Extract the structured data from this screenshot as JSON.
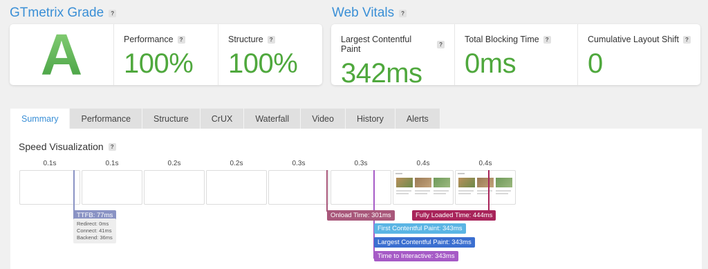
{
  "grade_section": {
    "title": "GTmetrix Grade",
    "help": "?",
    "grade": "A"
  },
  "grade_metrics": [
    {
      "label": "Performance",
      "help": "?",
      "value": "100%"
    },
    {
      "label": "Structure",
      "help": "?",
      "value": "100%"
    }
  ],
  "vitals_section": {
    "title": "Web Vitals",
    "help": "?"
  },
  "vitals": [
    {
      "label": "Largest Contentful Paint",
      "help": "?",
      "value": "342ms"
    },
    {
      "label": "Total Blocking Time",
      "help": "?",
      "value": "0ms"
    },
    {
      "label": "Cumulative Layout Shift",
      "help": "?",
      "value": "0"
    }
  ],
  "tabs": [
    "Summary",
    "Performance",
    "Structure",
    "CrUX",
    "Waterfall",
    "Video",
    "History",
    "Alerts"
  ],
  "active_tab": "Summary",
  "speed": {
    "title": "Speed Visualization",
    "help": "?",
    "frame_labels": [
      "0.1s",
      "0.1s",
      "0.2s",
      "0.2s",
      "0.3s",
      "0.3s",
      "0.4s",
      "0.4s"
    ],
    "markers": {
      "ttfb": "TTFB: 77ms",
      "onload": "Onload Time: 301ms",
      "fully_loaded": "Fully Loaded Time: 444ms",
      "fcp": "First Contentful Paint: 343ms",
      "lcp": "Largest Contentful Paint: 343ms",
      "tti": "Time to Interactive: 343ms"
    },
    "ttfb_details": [
      "Redirect: 0ms",
      "Connect: 41ms",
      "Backend: 36ms"
    ]
  },
  "colors": {
    "accent": "#3a8fd6",
    "grade_green": "#4fa83d",
    "ttfb": "#8a93c4",
    "onload": "#a8577a",
    "fully_loaded": "#a8245a",
    "fcp": "#5bb5e4",
    "lcp": "#3b6fd0",
    "tti": "#a65bc6"
  }
}
